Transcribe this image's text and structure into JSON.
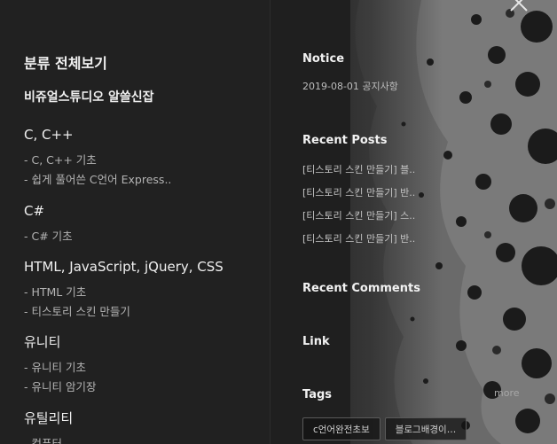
{
  "sidebar": {
    "all_categories": "분류 전체보기",
    "groups": [
      {
        "title": "비쥬얼스튜디오 알쓸신잡",
        "items": []
      },
      {
        "title": "C, C++",
        "items": [
          "- C, C++ 기초",
          "- 쉽게 풀어쓴 C언어 Express.."
        ]
      },
      {
        "title": "C#",
        "items": [
          "- C# 기초"
        ]
      },
      {
        "title": "HTML, JavaScript, jQuery, CSS",
        "items": [
          "- HTML 기초",
          "- 티스토리 스킨 만들기"
        ]
      },
      {
        "title": "유니티",
        "items": [
          "- 유니티 기초",
          "- 유니티 암기장"
        ]
      },
      {
        "title": "유틸리티",
        "items": [
          "- 컴퓨터"
        ]
      }
    ]
  },
  "notice": {
    "title": "Notice",
    "item": "2019-08-01 공지사항"
  },
  "recent_posts": {
    "title": "Recent Posts",
    "items": [
      "[티스토리 스킨 만들기] 블..",
      "[티스토리 스킨 만들기] 반..",
      "[티스토리 스킨 만들기] 스..",
      "[티스토리 스킨 만들기] 반.."
    ]
  },
  "recent_comments": {
    "title": "Recent Comments"
  },
  "link": {
    "title": "Link"
  },
  "tags": {
    "title": "Tags",
    "more_label": "more",
    "items": [
      "c언어완전초보",
      "블로그배경이…"
    ]
  },
  "icons": {
    "close": "close-icon"
  },
  "colors": {
    "background": "#1f1f1f",
    "text_primary": "#f2f2f2",
    "text_secondary": "#b4b4b4"
  }
}
